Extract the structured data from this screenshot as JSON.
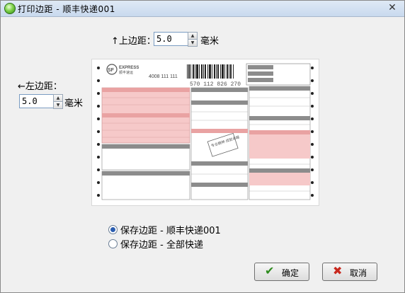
{
  "window": {
    "title": "打印边距 - 顺丰快递001",
    "close_glyph": "✕"
  },
  "top_margin": {
    "label": "↑上边距：",
    "value": "5.0",
    "unit": "毫米"
  },
  "left_margin": {
    "label": "←左边距：",
    "value": "5.0",
    "unit": "毫米"
  },
  "preview": {
    "brand_logo": "SF",
    "brand_en": "EXPRESS",
    "brand_cn": "顺丰速运",
    "hotline": "4008 111 111",
    "waybill_number": "570 112 826 270",
    "stamp_text": "专业精神 成就卓越"
  },
  "save_options": {
    "option_current": "保存边距 - 顺丰快递001",
    "option_all": "保存边距 - 全部快递",
    "selected": "option_current"
  },
  "buttons": {
    "ok": "确定",
    "cancel": "取消"
  },
  "icons": {
    "app": "green-circle-icon",
    "close": "close-icon",
    "ok": "checkmark-icon",
    "cancel": "red-x-icon"
  },
  "colors": {
    "form_pink": "#f6c9c9",
    "form_grey": "#8c8c8c",
    "ok_check": "#2e8b1e",
    "cancel_x": "#c8271d"
  }
}
